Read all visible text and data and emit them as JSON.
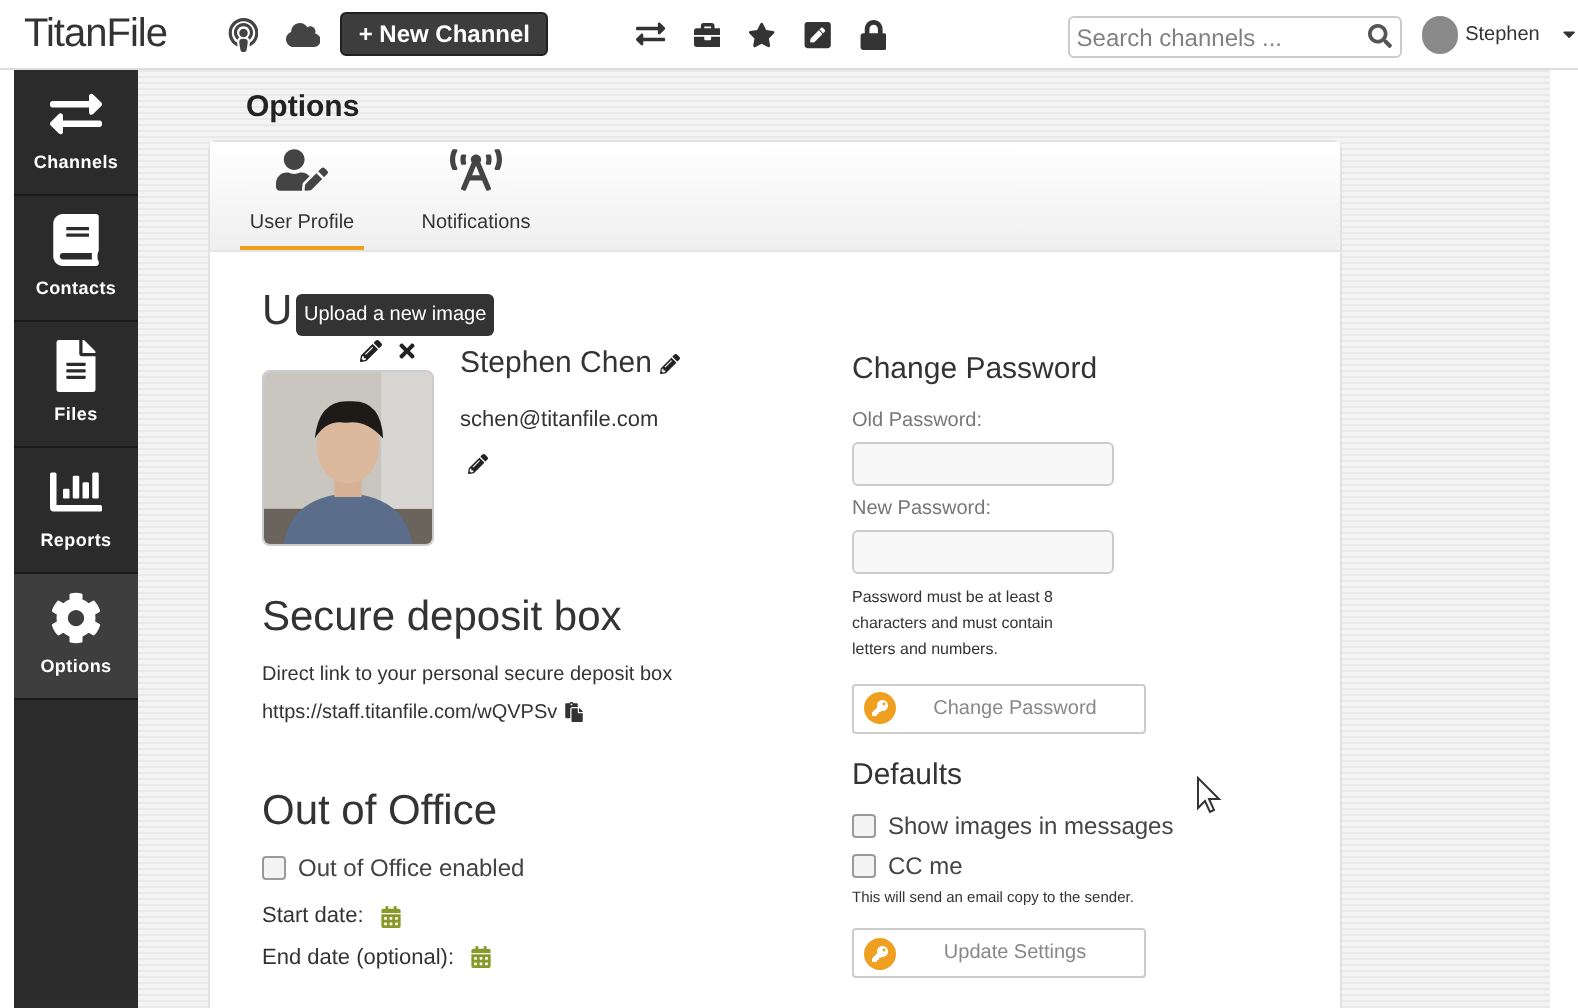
{
  "topbar": {
    "logo": "TitanFile",
    "new_channel": "+ New Channel",
    "search": {
      "placeholder": "Search channels ..."
    },
    "user": "Stephen"
  },
  "sidebar": {
    "items": [
      {
        "kind": "channels",
        "label": "Channels",
        "selected": false
      },
      {
        "kind": "contacts",
        "label": "Contacts",
        "selected": false
      },
      {
        "kind": "files",
        "label": "Files",
        "selected": false
      },
      {
        "kind": "reports",
        "label": "Reports",
        "selected": false
      },
      {
        "kind": "options",
        "label": "Options",
        "selected": true
      }
    ]
  },
  "page_title": "Options",
  "tabs": [
    {
      "kind": "profile",
      "label": "User Profile",
      "selected": true
    },
    {
      "kind": "notifications",
      "label": "Notifications",
      "selected": false
    }
  ],
  "profile": {
    "heading": "U",
    "tooltip": "Upload a new image",
    "name": "Stephen Chen",
    "email": "schen@titanfile.com"
  },
  "deposit": {
    "heading": "Secure deposit box",
    "description": "Direct link to your personal secure deposit box",
    "link": "https://staff.titanfile.com/wQVPSv"
  },
  "out_of_office": {
    "heading": "Out of Office",
    "enabled": {
      "label": "Out of Office enabled",
      "checked": false
    },
    "start_label": "Start date:",
    "end_label": "End date (optional):"
  },
  "password": {
    "heading": "Change Password",
    "old_label": "Old Password:",
    "new_label": "New Password:",
    "hint": "Password must be at least 8 characters and must contain letters and numbers.",
    "button": "Change Password"
  },
  "defaults": {
    "heading": "Defaults",
    "options": [
      {
        "label": "Show images in messages",
        "checked": false
      },
      {
        "label": "CC me",
        "checked": false
      }
    ],
    "note": "This will send an email copy to the sender.",
    "button": "Update Settings"
  }
}
